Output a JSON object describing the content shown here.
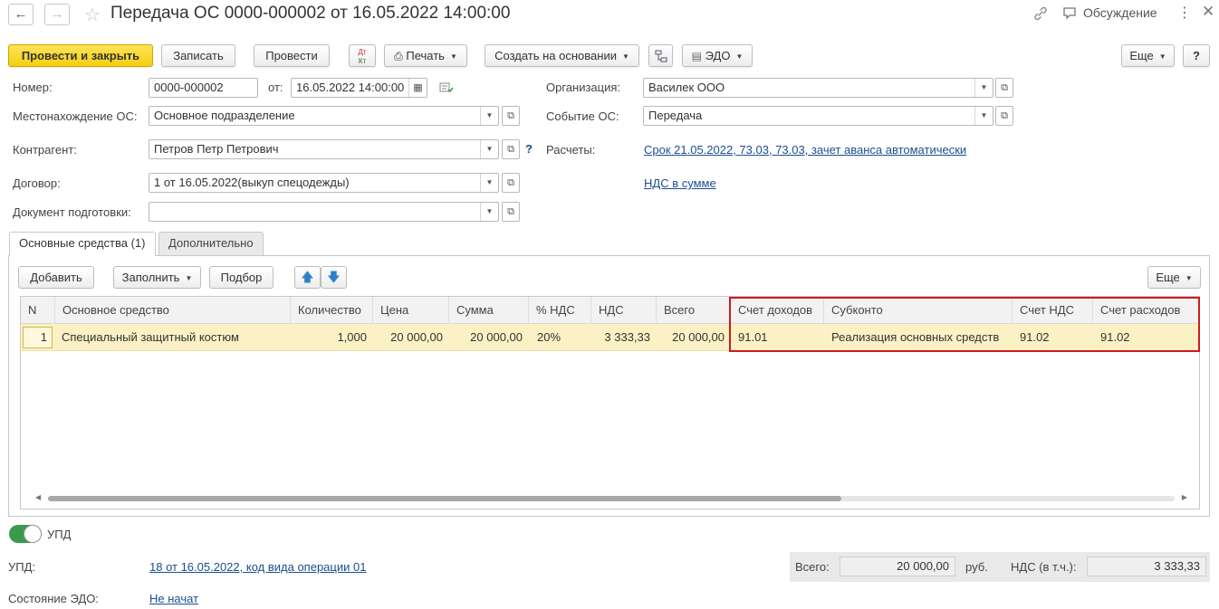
{
  "window": {
    "title": "Передача ОС 0000-000002 от 16.05.2022 14:00:00",
    "discussion_label": "Обсуждение"
  },
  "toolbar": {
    "post_close": "Провести и закрыть",
    "save": "Записать",
    "post": "Провести",
    "dt_kt_top": "Дт",
    "dt_kt_bottom": "Кт",
    "print": "Печать",
    "create_based": "Создать на основании",
    "edo": "ЭДО",
    "more": "Еще",
    "help": "?"
  },
  "form": {
    "number_label": "Номер:",
    "number_value": "0000-000002",
    "date_label": "от:",
    "date_value": "16.05.2022 14:00:00",
    "location_label": "Местонахождение ОС:",
    "location_value": "Основное подразделение",
    "counterparty_label": "Контрагент:",
    "counterparty_value": "Петров Петр Петрович",
    "contract_label": "Договор:",
    "contract_value": "1 от 16.05.2022(выкуп спецодежды)",
    "prep_doc_label": "Документ подготовки:",
    "prep_doc_value": "",
    "org_label": "Организация:",
    "org_value": "Василек ООО",
    "event_label": "Событие ОС:",
    "event_value": "Передача",
    "settlements_label": "Расчеты:",
    "settlements_link": "Срок 21.05.2022, 73.03, 73.03, зачет аванса автоматически",
    "vat_link": "НДС в сумме",
    "question": "?"
  },
  "tabs": [
    {
      "label": "Основные средства (1)",
      "active": true
    },
    {
      "label": "Дополнительно",
      "active": false
    }
  ],
  "table_toolbar": {
    "add": "Добавить",
    "fill": "Заполнить",
    "pick": "Подбор",
    "more": "Еще"
  },
  "table": {
    "columns": [
      "N",
      "Основное средство",
      "Количество",
      "Цена",
      "Сумма",
      "% НДС",
      "НДС",
      "Всего",
      "Счет доходов",
      "Субконто",
      "Счет НДС",
      "Счет расходов"
    ],
    "rows": [
      [
        "1",
        "Специальный защитный костюм",
        "1,000",
        "20 000,00",
        "20 000,00",
        "20%",
        "3 333,33",
        "20 000,00",
        "91.01",
        "Реализация основных средств",
        "91.02",
        "91.02"
      ]
    ]
  },
  "footer": {
    "upd_toggle_label": "УПД",
    "upd_label": "УПД:",
    "upd_link": "18 от 16.05.2022, код вида операции 01",
    "edo_state_label": "Состояние ЭДО:",
    "edo_state_link": "Не начат",
    "total_label": "Всего:",
    "total_value": "20 000,00",
    "currency": "руб.",
    "vat_label": "НДС (в т.ч.):",
    "vat_value": "3 333,33"
  },
  "colors": {
    "primary_button": "#f5cf10",
    "highlight_box": "#d0191d",
    "selected_row": "#fbf1c4",
    "link": "#1a4f8f",
    "toggle_on": "#3a9a4c"
  }
}
